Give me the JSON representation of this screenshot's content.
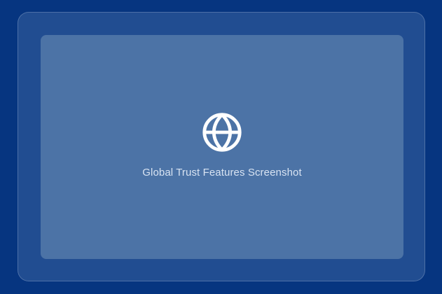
{
  "placeholder": {
    "icon": "globe-icon",
    "caption": "Global Trust Features Screenshot"
  },
  "colors": {
    "background": "#063580",
    "outer_card": "#214d91",
    "inner_panel": "#4c73a6",
    "icon": "#ffffff",
    "caption_text": "#d8e3f2"
  }
}
